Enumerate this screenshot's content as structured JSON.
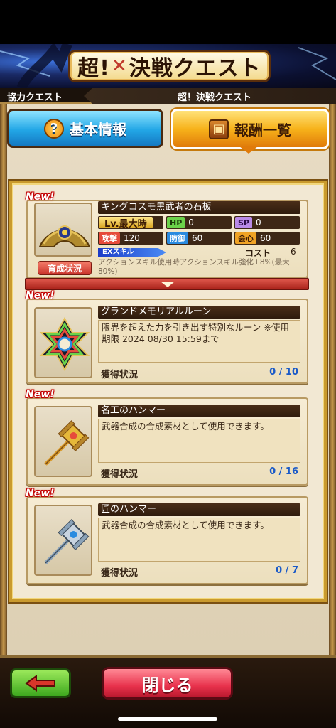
{
  "banner": {
    "title_left": "超!",
    "title_mark": "✕",
    "title_right": "決戦クエスト"
  },
  "breadcrumb": {
    "parent": "協力クエスト",
    "current": "超！決戦クエスト"
  },
  "tabs": [
    {
      "label": "基本情報",
      "icon": "question-icon",
      "active": false
    },
    {
      "label": "報酬一覧",
      "icon": "treasure-chest-icon",
      "active": true
    }
  ],
  "rewards": [
    {
      "new_label": "New!",
      "name": "キングコスモ黒武者の石板",
      "level_label": "Lv.最大時",
      "hp_label": "HP",
      "hp": "0",
      "sp_label": "SP",
      "sp": "0",
      "atk_label": "攻撃",
      "atk": "120",
      "def_label": "防御",
      "def": "60",
      "crit_label": "会心",
      "crit": "60",
      "ex_skill_label": "EXスキル",
      "cost_label": "コスト",
      "cost": "6",
      "skill_text": "アクションスキル使用時アクションスキル強化+8%(最大80%)",
      "grow_button": "育成状況"
    },
    {
      "new_label": "New!",
      "name": "グランドメモリアルルーン",
      "description": "限界を超えた力を引き出す特別なルーン ※使用期限 2024 08/30 15:59まで",
      "status_label": "獲得状況",
      "count": "0 / 10"
    },
    {
      "new_label": "New!",
      "name": "名工のハンマー",
      "description": "武器合成の合成素材として使用できます。",
      "status_label": "獲得状況",
      "count": "0 / 16"
    },
    {
      "new_label": "New!",
      "name": "匠のハンマー",
      "description": "武器合成の合成素材として使用できます。",
      "status_label": "獲得状況",
      "count": "0 / 7"
    }
  ],
  "footer": {
    "back_icon": "left-arrow-icon",
    "close_label": "閉じる"
  },
  "colors": {
    "accent_orange": "#f7b21a",
    "tab_blue": "#22a6e6",
    "close_red": "#e8324c",
    "back_green": "#3da81e",
    "count_blue": "#1a5ac8"
  }
}
